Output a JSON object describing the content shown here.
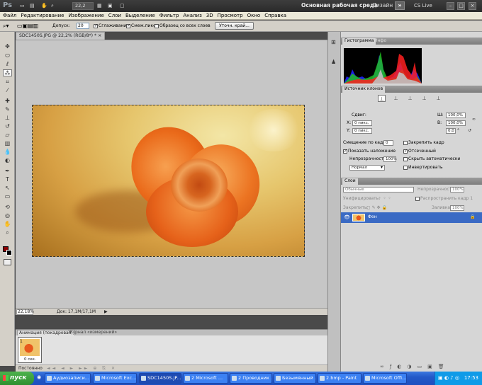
{
  "app": {
    "logo": "Ps",
    "zoom_value": "22,2",
    "workspace": "Основная рабочая среда",
    "design": "Дизайн",
    "more": "»",
    "cslive": "CS Live",
    "window_controls": [
      "–",
      "□",
      "×"
    ]
  },
  "menu": [
    "Файл",
    "Редактирование",
    "Изображение",
    "Слои",
    "Выделение",
    "Фильтр",
    "Анализ",
    "3D",
    "Просмотр",
    "Окно",
    "Справка"
  ],
  "options": {
    "tolerance_label": "Допуск:",
    "tolerance_value": "20",
    "antialias_label": "Сглаживание",
    "contiguous_label": "Смеж.пикс.",
    "all_layers_label": "Образец со всех слоев",
    "refine_button": "Уточн. край..."
  },
  "document": {
    "tab_title": "SDC1450S.JPG @ 22,2% (RGB/8*) *",
    "tab_close": "×",
    "status_zoom": "22,18%",
    "status_doc": "Док: 17,1M/17,1M",
    "status_arrow": "▶"
  },
  "animation": {
    "tab_active": "Анимация (покадровая)",
    "tab_inactive": "Журнал «измерений»",
    "frame_number": "1",
    "frame_delay": "0 сек.",
    "loop": "Постоянно",
    "controls": "◄◄ ◄ ► ►► ⊕ ⎘ ✕"
  },
  "histogram": {
    "tab_active": "Гистограмма",
    "tab_inactive": "Инфо"
  },
  "clone": {
    "tab": "Источник клонов",
    "offset_label": "Сдвиг:",
    "x_label": "X:",
    "y_label": "Y:",
    "x_value": "0 пикс.",
    "y_value": "0 пикс.",
    "w_label": "Ш:",
    "h_label": "В:",
    "w_value": "100,0%",
    "h_value": "100,0%",
    "angle_value": "0,0",
    "angle_unit": "°",
    "frame_offset_label": "Смещение по кадрам:",
    "frame_offset_value": "0",
    "lock_frame_label": "Закрепить кадр",
    "show_overlay_label": "Показать наложение",
    "clipped_label": "Отсеченный",
    "opacity_label": "Непрозрачность:",
    "opacity_value": "100%",
    "auto_hide_label": "Скрыть автоматически",
    "mode_value": "Нормал",
    "invert_label": "Инвертировать"
  },
  "layers": {
    "tab": "Слои",
    "blend_mode": "Обычные",
    "opacity_label": "Непрозрачность:",
    "opacity_value": "100%",
    "unify_label": "Унифицировать:",
    "propagate_label": "Распространить кадр 1",
    "lock_label": "Закрепить:",
    "fill_label": "Заливка:",
    "fill_value": "100%",
    "layer_name": "Фон"
  },
  "taskbar": {
    "start": "пуск",
    "tasks": [
      "Аудиозаписи...",
      "Microsoft Exc...",
      "SDC1450S.JP...",
      "2 Microsoft ...",
      "2 Проводник ...",
      "Безымянный ...",
      "2.bmp - Paint",
      "Microsoft Offi..."
    ],
    "clock": "17:53"
  },
  "colors": {
    "foreground": "#8b0000",
    "background": "#000000",
    "taskbar": "#245edb"
  }
}
